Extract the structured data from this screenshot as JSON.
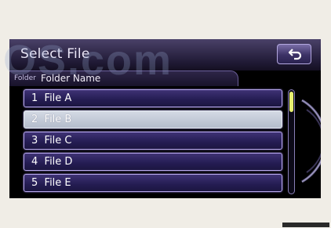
{
  "header": {
    "title": "Select File",
    "back_icon": "return-arrow-icon"
  },
  "folder": {
    "label": "Folder",
    "name": "Folder Name"
  },
  "files": [
    {
      "label": "1  File A",
      "selected": false
    },
    {
      "label": "2  File B",
      "selected": true
    },
    {
      "label": "3  File C",
      "selected": false
    },
    {
      "label": "4  File D",
      "selected": false
    },
    {
      "label": "5  File E",
      "selected": false
    }
  ],
  "scroll": {
    "visible_fraction": 0.2,
    "position_fraction": 0.0
  },
  "watermark": {
    "text": "OS.com"
  },
  "colors": {
    "row_bg": "#2a2060",
    "row_border": "#b8a8ee",
    "selected_bg": "#c8ced8",
    "scroll_thumb": "#e8f070",
    "header_bg": "#2a2240"
  }
}
